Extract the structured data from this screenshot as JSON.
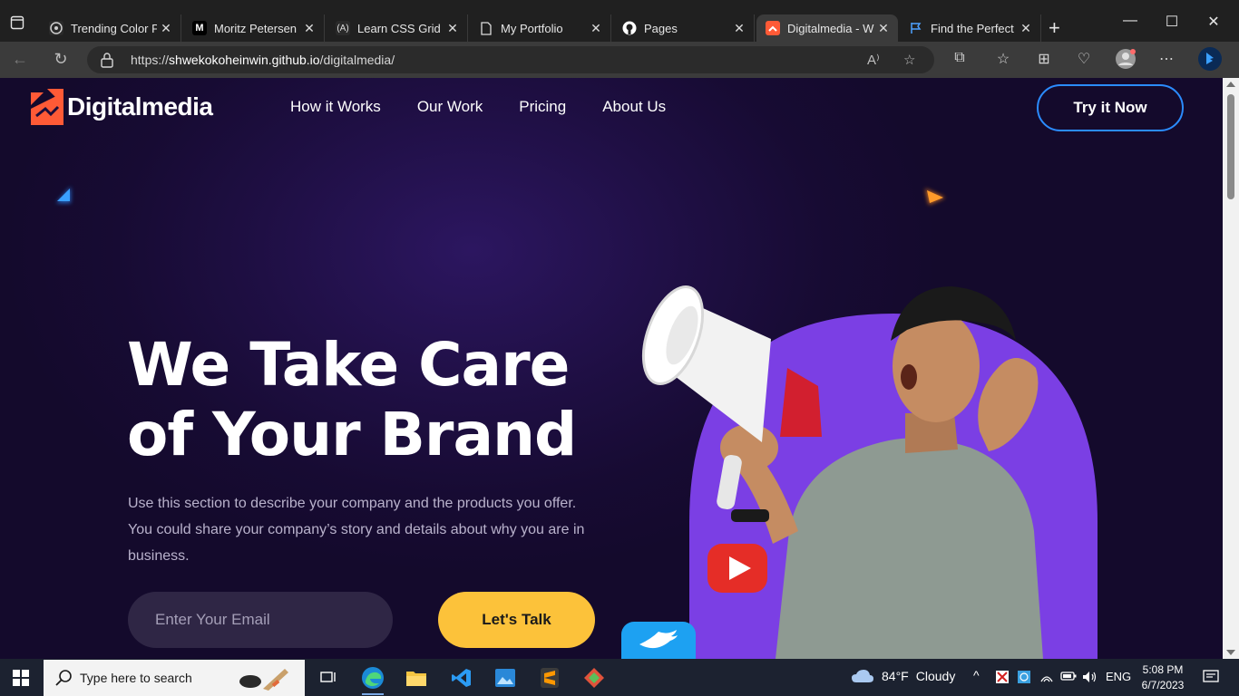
{
  "browser": {
    "tabs": [
      {
        "title": "Trending Color Pa",
        "favicon": "chatgpt-icon",
        "active": false
      },
      {
        "title": "Moritz Petersen -",
        "favicon": "medium-icon",
        "active": false
      },
      {
        "title": "Learn CSS Grid by",
        "favicon": "code-icon",
        "active": false
      },
      {
        "title": "My Portfolio",
        "favicon": "page-icon",
        "active": false
      },
      {
        "title": "Pages",
        "favicon": "github-icon",
        "active": false
      },
      {
        "title": "Digitalmedia - W",
        "favicon": "digitalmedia-icon",
        "active": true
      },
      {
        "title": "Find the Perfect I",
        "favicon": "flag-icon",
        "active": false
      }
    ],
    "url_prefix": "https://",
    "url_host": "shwekokoheinwin.github.io",
    "url_path": "/digitalmedia/"
  },
  "site": {
    "logo_text": "Digitalmedia",
    "nav": [
      "How it Works",
      "Our Work",
      "Pricing",
      "About Us"
    ],
    "cta_button": "Try it Now",
    "hero_title_line1": "We Take Care",
    "hero_title_line2": "of Your Brand",
    "hero_description": "Use this section to describe your company and the products you offer. You could share your company’s story and details about why you are in business.",
    "email_placeholder": "Enter Your Email",
    "talk_button": "Let's Talk"
  },
  "taskbar": {
    "search_placeholder": "Type here to search",
    "weather_temp": "84°F",
    "weather_text": "Cloudy",
    "language": "ENG",
    "time": "5:08 PM",
    "date": "6/7/2023"
  },
  "colors": {
    "accent_orange": "#ff5a36",
    "cta_border": "#2b8cff",
    "talk_yellow": "#fcc23a",
    "hero_purple": "#7b3fe4"
  }
}
